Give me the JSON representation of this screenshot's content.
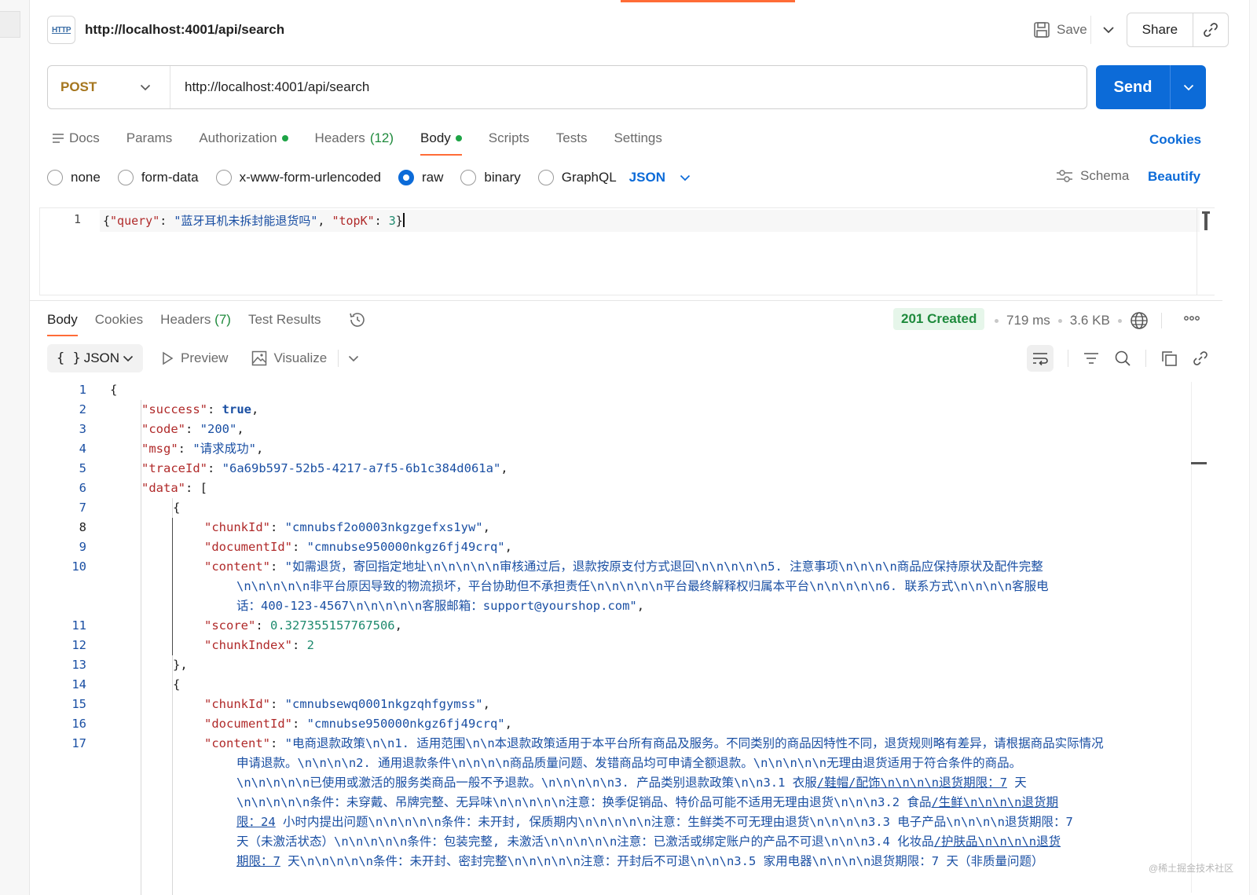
{
  "request": {
    "title": "http://localhost:4001/api/search",
    "icon_text": "HTTP",
    "save_label": "Save",
    "share_label": "Share",
    "method": "POST",
    "url": "http://localhost:4001/api/search",
    "send_label": "Send",
    "tabs": [
      {
        "label": "Docs"
      },
      {
        "label": "Params"
      },
      {
        "label": "Authorization"
      },
      {
        "label": "Headers",
        "count": "(12)"
      },
      {
        "label": "Body"
      },
      {
        "label": "Scripts"
      },
      {
        "label": "Tests"
      },
      {
        "label": "Settings"
      }
    ],
    "cookies_label": "Cookies",
    "body_modes": [
      "none",
      "form-data",
      "x-www-form-urlencoded",
      "raw",
      "binary",
      "GraphQL"
    ],
    "selected_mode": "raw",
    "body_format": "JSON",
    "schema_label": "Schema",
    "beautify_label": "Beautify",
    "editor_line_number": "1",
    "body_code": {
      "open": "{",
      "k1": "\"query\"",
      "c1": ": ",
      "v1": "\"蓝牙耳机未拆封能退货吗\"",
      "c2": ", ",
      "k2": "\"topK\"",
      "c3": ": ",
      "v2": "3",
      "close": "}"
    }
  },
  "response": {
    "tabs": [
      {
        "label": "Body"
      },
      {
        "label": "Cookies"
      },
      {
        "label": "Headers",
        "count": "(7)"
      },
      {
        "label": "Test Results"
      }
    ],
    "status": "201 Created",
    "time": "719 ms",
    "size": "3.6 KB",
    "view_mode": "JSON",
    "preview_label": "Preview",
    "visualize_label": "Visualize",
    "line_numbers": [
      "1",
      "2",
      "3",
      "4",
      "5",
      "6",
      "7",
      "8",
      "9",
      "10",
      "11",
      "12",
      "13",
      "14",
      "15",
      "16",
      "17"
    ],
    "code": {
      "l1": "{",
      "success_k": "\"success\"",
      "success_v": "true",
      "code_k": "\"code\"",
      "code_v": "\"200\"",
      "msg_k": "\"msg\"",
      "msg_v": "\"请求成功\"",
      "trace_k": "\"traceId\"",
      "trace_v": "\"6a69b597-52b5-4217-a7f5-6b1c384d061a\"",
      "data_k": "\"data\"",
      "data_open": ": [",
      "obj_open": "{",
      "obj_close": "},",
      "chunk_k": "\"chunkId\"",
      "doc_k": "\"documentId\"",
      "content_k": "\"content\"",
      "score_k": "\"score\"",
      "chunkidx_k": "\"chunkIndex\"",
      "item1": {
        "chunkId": "\"cmnubsf2o0003nkgzgefxs1yw\"",
        "documentId": "\"cmnubse950000nkgz6fj49crq\"",
        "content_l1": "\"如需退货，寄回指定地址\\n\\n\\n\\n\\n审核通过后，退款按原支付方式退回\\n\\n\\n\\n\\n5. 注意事项\\n\\n\\n\\n商品应保持原状及配件完整",
        "content_l2": "\\n\\n\\n\\n\\n非平台原因导致的物流损坏，平台协助但不承担责任\\n\\n\\n\\n\\n平台最终解释权归属本平台\\n\\n\\n\\n\\n6. 联系方式\\n\\n\\n\\n客服电",
        "content_l3": "话：400-123-4567\\n\\n\\n\\n\\n客服邮箱：support@yourshop.com\"",
        "score": "0.327355157767506",
        "chunkIndex": "2"
      },
      "item2": {
        "chunkId": "\"cmnubsewq0001nkgzqhfgymss\"",
        "documentId": "\"cmnubse950000nkgz6fj49crq\"",
        "content_l1": "\"电商退款政策\\n\\n1. 适用范围\\n\\n本退款政策适用于本平台所有商品及服务。不同类别的商品因特性不同，退货规则略有差异，请根据商品实际情况",
        "content_l2": "申请退款。\\n\\n\\n\\n2. 通用退款条件\\n\\n\\n\\n商品质量问题、发错商品均可申请全额退款。\\n\\n\\n\\n\\n无理由退货适用于符合条件的商品。",
        "content_l3a": "\\n\\n\\n\\n\\n已使用或激活的服务类商品一般不予退款。\\n\\n\\n\\n\\n3. 产品类别退款政策\\n\\n3.1 衣服",
        "content_l3b": "/鞋帽/配饰\\n\\n\\n\\n退货期限：7",
        "content_l3c": " 天",
        "content_l4a": "\\n\\n\\n\\n\\n条件：未穿戴、吊牌完整、无异味\\n\\n\\n\\n\\n注意：换季促销品、特价品可能不适用无理由退货\\n\\n\\n3.2 食品",
        "content_l4b": "/生鲜\\n\\n\\n\\n退货期",
        "content_l5a": "限：24",
        "content_l5b": " 小时内提出问题\\n\\n\\n\\n\\n条件：未开封, 保质期内\\n\\n\\n\\n\\n注意：生鲜类不可无理由退货\\n\\n\\n\\n3.3 电子产品\\n\\n\\n\\n退货期限：7",
        "content_l6a": "天（未激活状态）\\n\\n\\n\\n\\n条件：包装完整, 未激活\\n\\n\\n\\n\\n注意：已激活或绑定账户的产品不可退\\n\\n\\n3.4 化妆品",
        "content_l6b": "/护肤品\\n\\n\\n\\n退货",
        "content_l7a": "期限：7",
        "content_l7b": " 天\\n\\n\\n\\n\\n条件：未开封、密封完整\\n\\n\\n\\n\\n注意：开封后不可退\\n\\n\\n3.5 家用电器\\n\\n\\n\\n退货期限：7 天（非质量问题）"
      }
    }
  },
  "watermark": "@稀土掘金技术社区"
}
